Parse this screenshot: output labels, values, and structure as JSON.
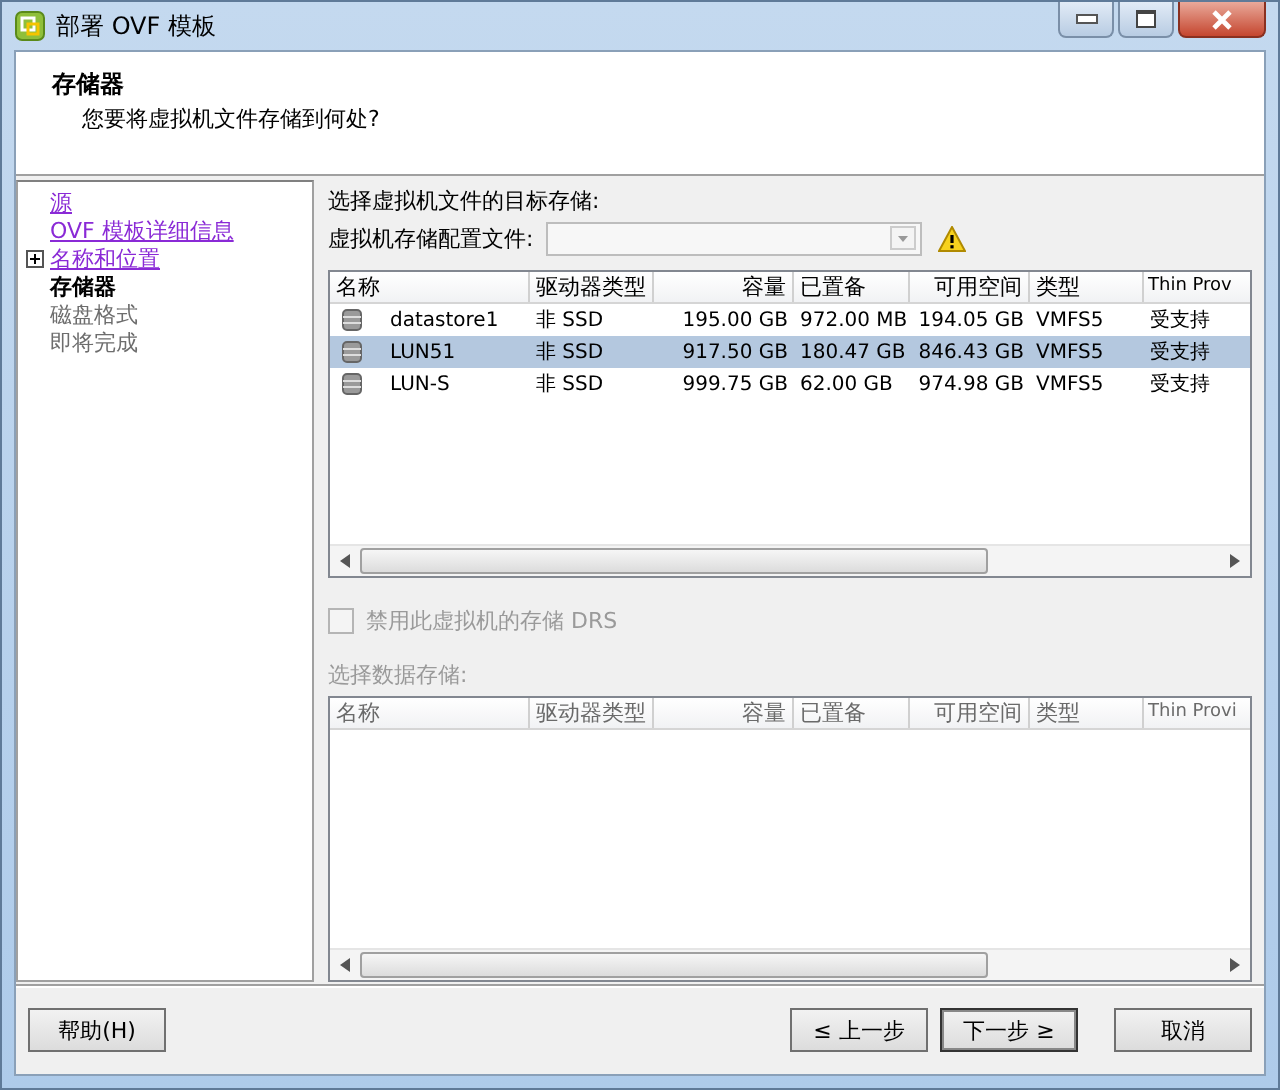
{
  "window": {
    "title": "部署 OVF 模板"
  },
  "header": {
    "title": "存储器",
    "subtitle": "您要将虚拟机文件存储到何处?"
  },
  "nav": [
    {
      "label": "源",
      "kind": "link"
    },
    {
      "label": "OVF 模板详细信息",
      "kind": "link"
    },
    {
      "label": "名称和位置",
      "kind": "link-expandable",
      "expanded": false
    },
    {
      "label": "存储器",
      "kind": "current"
    },
    {
      "label": "磁盘格式",
      "kind": "pending"
    },
    {
      "label": "即将完成",
      "kind": "pending"
    }
  ],
  "target_label": "选择虚拟机文件的目标存储:",
  "profile": {
    "label": "虚拟机存储配置文件:",
    "disabled": true,
    "warning": true
  },
  "table": {
    "columns": [
      "名称",
      "驱动器类型",
      "容量",
      "已置备",
      "可用空间",
      "类型",
      "Thin Prov"
    ],
    "rows": [
      {
        "selected": false,
        "cells": [
          "datastore1",
          "非 SSD",
          "195.00 GB",
          "972.00 MB",
          "194.05 GB",
          "VMFS5",
          "受支持"
        ]
      },
      {
        "selected": true,
        "cells": [
          "LUN51",
          "非 SSD",
          "917.50 GB",
          "180.47 GB",
          "846.43 GB",
          "VMFS5",
          "受支持"
        ]
      },
      {
        "selected": false,
        "cells": [
          "LUN-S",
          "非 SSD",
          "999.75 GB",
          "62.00 GB",
          "974.98 GB",
          "VMFS5",
          "受支持"
        ]
      }
    ]
  },
  "drs": {
    "label": "禁用此虚拟机的存储 DRS",
    "checked": false,
    "disabled": true
  },
  "datastore_label": "选择数据存储:",
  "table2": {
    "columns": [
      "名称",
      "驱动器类型",
      "容量",
      "已置备",
      "可用空间",
      "类型",
      "Thin Provi"
    ]
  },
  "buttons": [
    {
      "label": "帮助(H)",
      "kind": "left",
      "default": false
    },
    {
      "label": "≤ 上一步",
      "kind": "right",
      "default": false
    },
    {
      "label": "下一步 ≥",
      "kind": "right",
      "default": true
    },
    {
      "label": "取消",
      "kind": "right",
      "default": false
    }
  ]
}
